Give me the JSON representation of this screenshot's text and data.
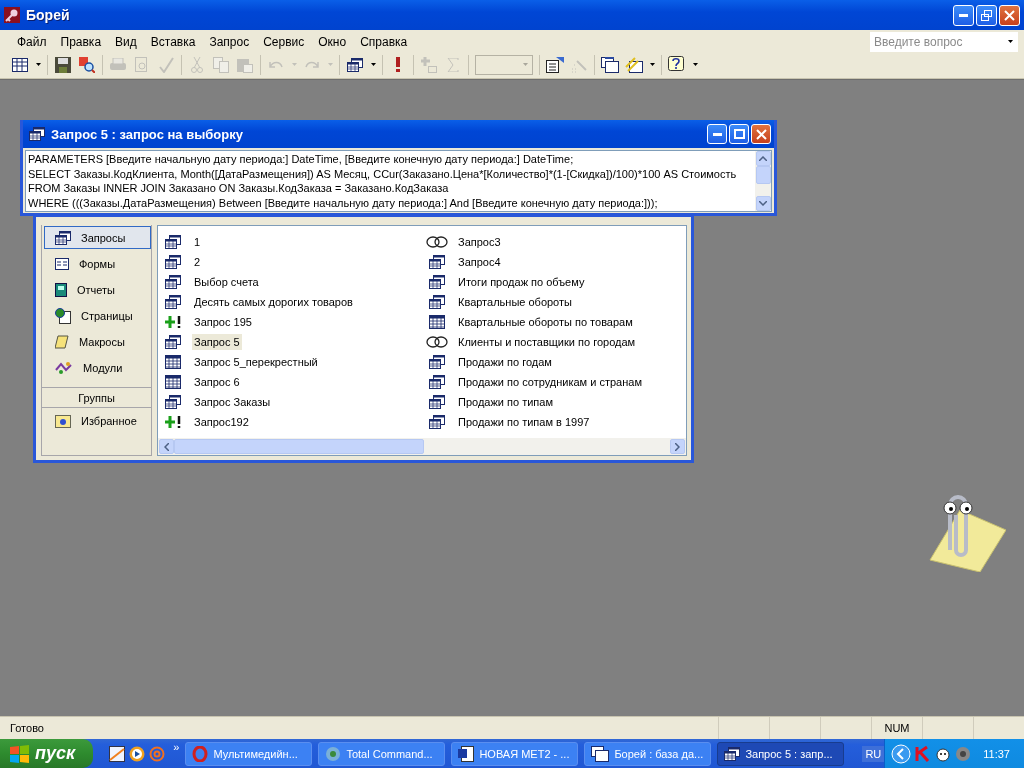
{
  "window": {
    "title": "Борей"
  },
  "menu": [
    "Файл",
    "Правка",
    "Вид",
    "Вставка",
    "Запрос",
    "Сервис",
    "Окно",
    "Справка"
  ],
  "ask_field": {
    "placeholder": "Введите вопрос"
  },
  "toolbar": [
    {
      "kind": "view",
      "disabled": false
    },
    {
      "kind": "caret",
      "disabled": false
    },
    {
      "kind": "sep"
    },
    {
      "kind": "save",
      "disabled": false
    },
    {
      "kind": "search",
      "disabled": false
    },
    {
      "kind": "sep"
    },
    {
      "kind": "print",
      "disabled": true
    },
    {
      "kind": "preview",
      "disabled": true
    },
    {
      "kind": "spell",
      "disabled": true
    },
    {
      "kind": "sep"
    },
    {
      "kind": "cut",
      "disabled": true
    },
    {
      "kind": "copy",
      "disabled": true
    },
    {
      "kind": "paste",
      "disabled": true
    },
    {
      "kind": "sep"
    },
    {
      "kind": "undo",
      "disabled": true
    },
    {
      "kind": "caret",
      "disabled": true
    },
    {
      "kind": "redo",
      "disabled": true
    },
    {
      "kind": "caret",
      "disabled": true
    },
    {
      "kind": "sep"
    },
    {
      "kind": "query",
      "disabled": false
    },
    {
      "kind": "caret",
      "disabled": false
    },
    {
      "kind": "sep"
    },
    {
      "kind": "run",
      "disabled": false
    },
    {
      "kind": "sep"
    },
    {
      "kind": "table",
      "disabled": true
    },
    {
      "kind": "sum",
      "disabled": true
    },
    {
      "kind": "sep"
    },
    {
      "kind": "combo",
      "disabled": true
    },
    {
      "kind": "sep"
    },
    {
      "kind": "properties",
      "disabled": false
    },
    {
      "kind": "builder",
      "disabled": true
    },
    {
      "kind": "sep"
    },
    {
      "kind": "dbwindow",
      "disabled": false
    },
    {
      "kind": "newobject",
      "disabled": false
    },
    {
      "kind": "caret",
      "disabled": false
    },
    {
      "kind": "sep"
    },
    {
      "kind": "help",
      "disabled": false
    },
    {
      "kind": "caret",
      "disabled": false
    }
  ],
  "query_window": {
    "title": "Запрос 5 : запрос на выборку",
    "sql": [
      "PARAMETERS [Введите начальную дату периода:] DateTime, [Введите конечную дату периода:] DateTime;",
      "SELECT Заказы.КодКлиента, Month([ДатаРазмещения]) AS Месяц, CCur(Заказано.Цена*[Количество]*(1-[Скидка])/100)*100 AS Стоимость",
      "FROM Заказы INNER JOIN Заказано ON Заказы.КодЗаказа = Заказано.КодЗаказа",
      "WHERE (((Заказы.ДатаРазмещения) Between [Введите начальную дату периода:] And [Введите конечную дату периода:]));"
    ]
  },
  "database_window": {
    "objects": [
      {
        "label": "Запросы",
        "kind": "queries",
        "selected": true
      },
      {
        "label": "Формы",
        "kind": "forms",
        "selected": false
      },
      {
        "label": "Отчеты",
        "kind": "reports",
        "selected": false
      },
      {
        "label": "Страницы",
        "kind": "pages",
        "selected": false
      },
      {
        "label": "Макросы",
        "kind": "macros",
        "selected": false
      },
      {
        "label": "Модули",
        "kind": "modules",
        "selected": false
      }
    ],
    "groups_header": "Группы",
    "groups": [
      {
        "label": "Избранное",
        "selected": false
      }
    ],
    "queries": [
      [
        {
          "label": "1",
          "kind": "select",
          "selected": false
        },
        {
          "label": "2",
          "kind": "select",
          "selected": false
        },
        {
          "label": "Выбор счета",
          "kind": "select",
          "selected": false
        },
        {
          "label": "Десять самых дорогих товаров",
          "kind": "select",
          "selected": false
        },
        {
          "label": "Запрос 195",
          "kind": "append",
          "selected": false
        },
        {
          "label": "Запрос 5",
          "kind": "select",
          "selected": true
        },
        {
          "label": "Запрос 5_перекрестный",
          "kind": "crosstab",
          "selected": false
        },
        {
          "label": "Запрос 6",
          "kind": "crosstab",
          "selected": false
        },
        {
          "label": "Запрос Заказы",
          "kind": "select",
          "selected": false
        },
        {
          "label": "Запрос192",
          "kind": "append",
          "selected": false
        }
      ],
      [
        {
          "label": "Запрос3",
          "kind": "union",
          "selected": false
        },
        {
          "label": "Запрос4",
          "kind": "select",
          "selected": false
        },
        {
          "label": "Итоги продаж по объему",
          "kind": "select",
          "selected": false
        },
        {
          "label": "Квартальные обороты",
          "kind": "select",
          "selected": false
        },
        {
          "label": "Квартальные обороты по товарам",
          "kind": "crosstab",
          "selected": false
        },
        {
          "label": "Клиенты и поставщики по городам",
          "kind": "union",
          "selected": false
        },
        {
          "label": "Продажи по годам",
          "kind": "select",
          "selected": false
        },
        {
          "label": "Продажи по сотрудникам и странам",
          "kind": "select",
          "selected": false
        },
        {
          "label": "Продажи по типам",
          "kind": "select",
          "selected": false
        },
        {
          "label": "Продажи по типам в 1997",
          "kind": "select",
          "selected": false
        }
      ]
    ]
  },
  "status_bar": {
    "text": "Готово",
    "indicator": "NUM"
  },
  "taskbar": {
    "start": "пуск",
    "quick_launch": [
      {
        "kind": "mail"
      },
      {
        "kind": "player"
      },
      {
        "kind": "at"
      }
    ],
    "more": "»",
    "tasks": [
      {
        "label": "Мультимедийн...",
        "kind": "browser",
        "selected": false
      },
      {
        "label": "Total Command...",
        "kind": "filemanager",
        "selected": false
      },
      {
        "label": "НОВАЯ МЕТ2 - ...",
        "kind": "document",
        "selected": false
      },
      {
        "label": "Борей : база да...",
        "kind": "database",
        "selected": false
      },
      {
        "label": "Запрос 5 : запр...",
        "kind": "query",
        "selected": true
      }
    ],
    "language": "RU",
    "clock": "11:37"
  }
}
